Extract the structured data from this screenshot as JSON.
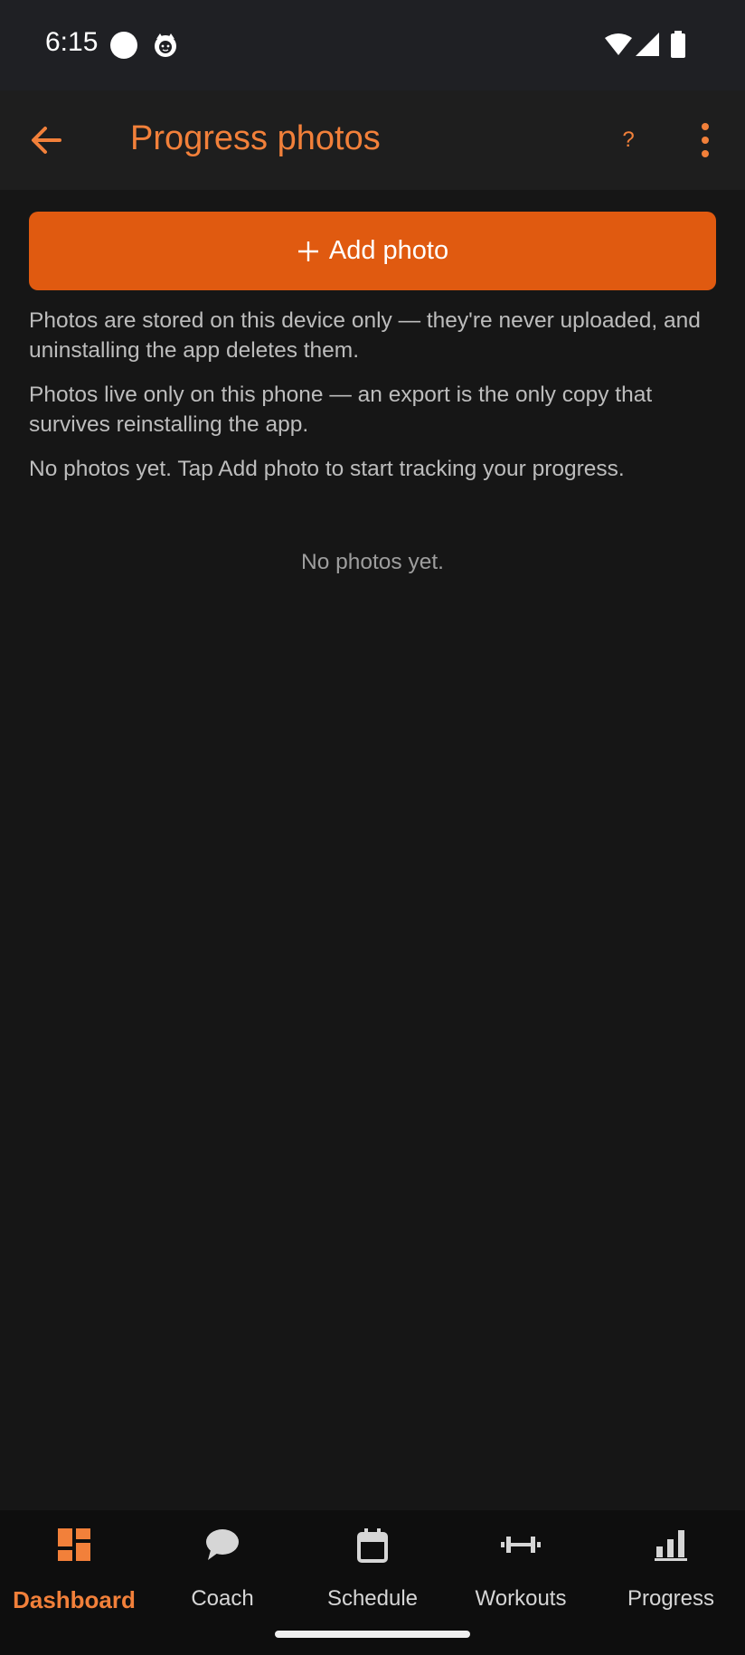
{
  "status_bar": {
    "time": "6:15"
  },
  "app_bar": {
    "title": "Progress photos",
    "help_label": "?"
  },
  "add_button": {
    "label": "Add photo"
  },
  "notes": {
    "storage": "Photos are stored on this device only — they're never uploaded, and uninstalling the app deletes them.",
    "export": "Photos live only on this phone — an export is the only copy that survives reinstalling the app.",
    "empty_hint": "No photos yet. Tap Add photo to start tracking your progress."
  },
  "empty_state": "No photos yet.",
  "bottom_nav": {
    "items": [
      {
        "label": "Dashboard",
        "icon": "dashboard-icon",
        "active": true
      },
      {
        "label": "Coach",
        "icon": "chat-bubble-icon",
        "active": false
      },
      {
        "label": "Schedule",
        "icon": "calendar-icon",
        "active": false
      },
      {
        "label": "Workouts",
        "icon": "dumbbell-icon",
        "active": false
      },
      {
        "label": "Progress",
        "icon": "bar-chart-icon",
        "active": false
      }
    ]
  },
  "colors": {
    "accent": "#f2803a",
    "button": "#e05a10",
    "background": "#161616",
    "appbar": "#1e1e1e",
    "statusbar": "#1f2024",
    "nav_background": "#0e0e0e"
  }
}
